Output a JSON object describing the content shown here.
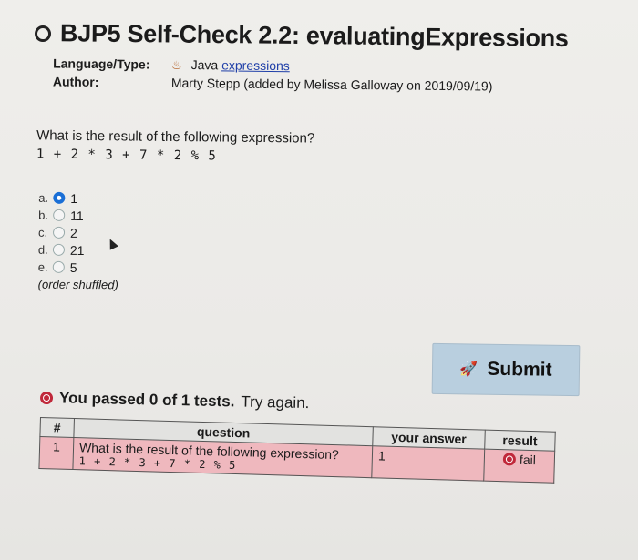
{
  "title": "BJP5 Self-Check 2.2: evaluatingExpressions",
  "meta": {
    "language_key": "Language/Type:",
    "language_value": "Java",
    "language_link": "expressions",
    "author_key": "Author:",
    "author_value": "Marty Stepp (added by Melissa Galloway on 2019/09/19)"
  },
  "question": {
    "prompt": "What is the result of the following expression?",
    "expression": "1 + 2 * 3 + 7 * 2 % 5"
  },
  "choices": [
    {
      "letter": "a.",
      "value": "1",
      "checked": true
    },
    {
      "letter": "b.",
      "value": "11",
      "checked": false
    },
    {
      "letter": "c.",
      "value": "2",
      "checked": false
    },
    {
      "letter": "d.",
      "value": "21",
      "checked": false
    },
    {
      "letter": "e.",
      "value": "5",
      "checked": false
    }
  ],
  "shuffled_note": "(order shuffled)",
  "submit_label": "Submit",
  "result": {
    "summary": "You passed 0 of 1 tests.",
    "try_again": "Try again."
  },
  "table": {
    "headers": [
      "#",
      "question",
      "your answer",
      "result"
    ],
    "rows": [
      {
        "num": "1",
        "question_text": "What is the result of the following expression?",
        "question_expr": "1 + 2 * 3 + 7 * 2 % 5",
        "answer": "1",
        "result": "fail"
      }
    ]
  },
  "colors": {
    "fail_red": "#c0283a",
    "row_pink": "#efb8be",
    "submit_bg": "#b9cfdf",
    "radio_checked": "#1a6fd6"
  }
}
